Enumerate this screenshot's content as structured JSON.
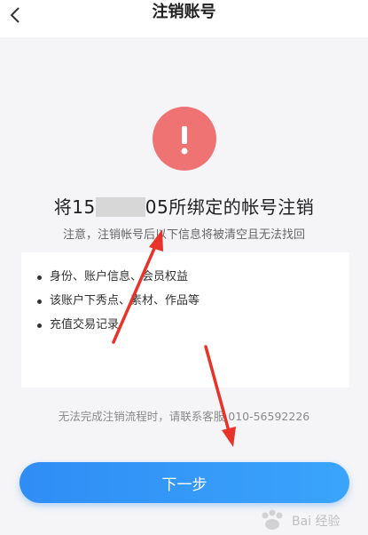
{
  "header": {
    "title": "注销账号"
  },
  "warning": {
    "icon": "exclamation-icon",
    "color": "#f07373"
  },
  "headline": {
    "prefix": "将15",
    "suffix": "05所绑定的帐号注销"
  },
  "subnote": "注意，注销帐号后以下信息将被清空且无法找回",
  "items": [
    {
      "label": "身份、账户信息、会员权益"
    },
    {
      "label": "该账户下秀点、素材、作品等"
    },
    {
      "label": "充值交易记录"
    }
  ],
  "contact": "无法完成注销流程时，请联系客服 010-56592226",
  "next_button": {
    "label": "下一步"
  },
  "watermark": {
    "text": "Bai 经验"
  },
  "colors": {
    "accent": "#2f8df5",
    "annotation": "#e8332a"
  }
}
